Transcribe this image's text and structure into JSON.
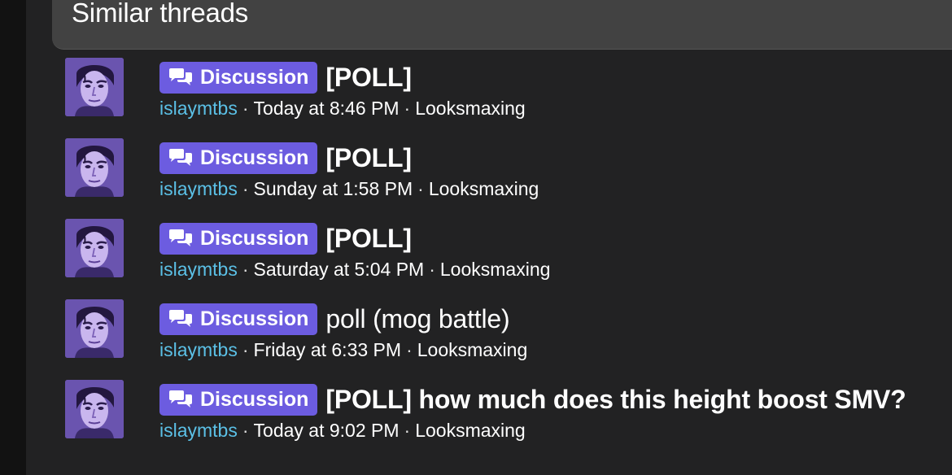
{
  "section": {
    "title": "Similar threads"
  },
  "threads": [
    {
      "label": "Discussion",
      "title": "[POLL]",
      "title_bold": true,
      "author": "islaymtbs",
      "date": "Today at 8:46 PM",
      "forum": "Looksmaxing",
      "separator": "·"
    },
    {
      "label": "Discussion",
      "title": "[POLL]",
      "title_bold": true,
      "author": "islaymtbs",
      "date": "Sunday at 1:58 PM",
      "forum": "Looksmaxing",
      "separator": "·"
    },
    {
      "label": "Discussion",
      "title": "[POLL]",
      "title_bold": true,
      "author": "islaymtbs",
      "date": "Saturday at 5:04 PM",
      "forum": "Looksmaxing",
      "separator": "·"
    },
    {
      "label": "Discussion",
      "title": "poll (mog battle)",
      "title_bold": false,
      "author": "islaymtbs",
      "date": "Friday at 6:33 PM",
      "forum": "Looksmaxing",
      "separator": "·"
    },
    {
      "label": "Discussion",
      "title": "[POLL] how much does this height boost SMV?",
      "title_bold": true,
      "author": "islaymtbs",
      "date": "Today at 9:02 PM",
      "forum": "Looksmaxing",
      "separator": "·"
    }
  ],
  "icons": {
    "badge_icon": "chat-bubbles-icon",
    "avatar": "user-avatar"
  },
  "colors": {
    "badge": "#6c5ce0",
    "author": "#5bc0e6",
    "header_bg": "#424242",
    "panel_bg": "#222223"
  }
}
